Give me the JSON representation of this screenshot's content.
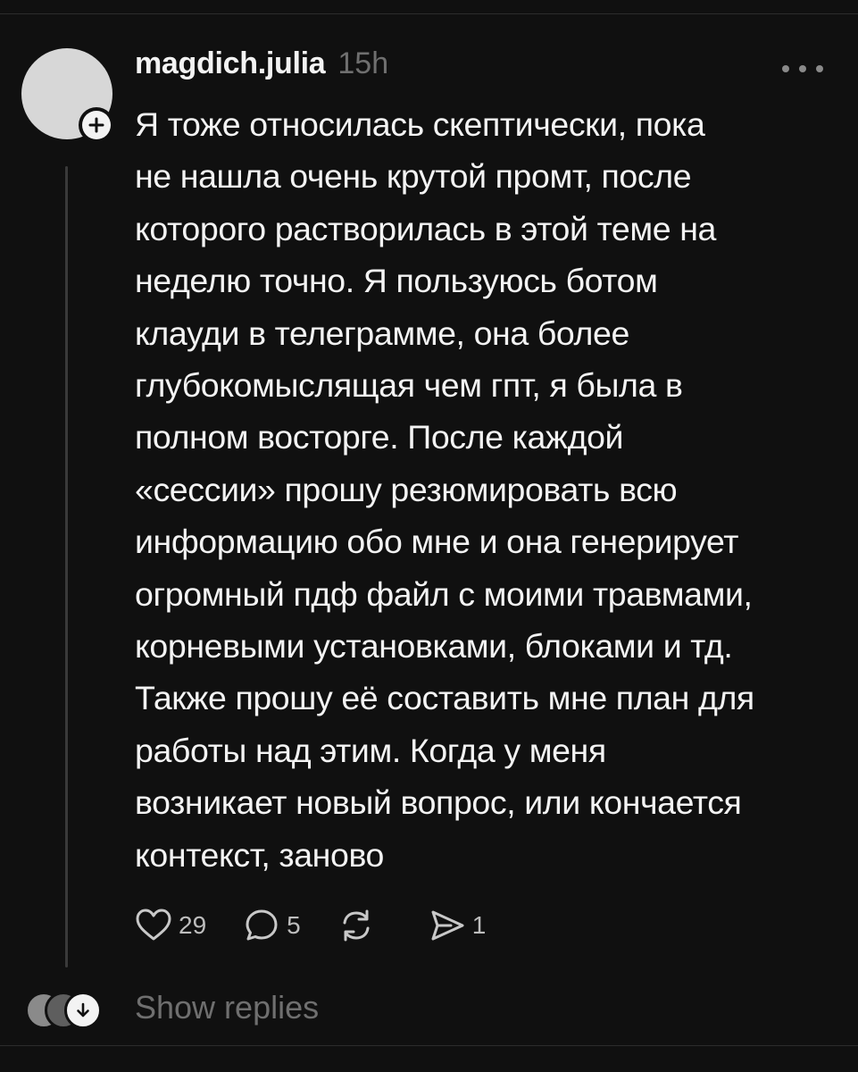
{
  "post": {
    "username": "magdich.julia",
    "timestamp": "15h",
    "text": "Я тоже относилась скептически, пока\nне нашла очень крутой промт, после\nкоторого растворилась в этой теме на\nнеделю точно. Я пользуюсь ботом\nклауди в телеграмме, она более\nглубокомыслящая чем гпт, я была в\nполном восторге. После каждой\n«сессии» прошу резюмировать всю\nинформацию обо мне и она генерирует\nогромный пдф файл с моими травмами,\nкорневыми установками, блоками и тд.\nТакже прошу её составить мне план для\nработы над этим. Когда у меня\nвозникает новый вопрос, или кончается\nконтекст,  заново"
  },
  "actions": {
    "likes": "29",
    "comments": "5",
    "shares": "1"
  },
  "replies": {
    "label": "Show replies"
  },
  "icons": {
    "more": "more-horizontal-icon",
    "follow": "plus-icon",
    "like": "heart-icon",
    "comment": "comment-icon",
    "repost": "repost-icon",
    "share": "send-icon",
    "expand": "arrow-down-icon"
  },
  "colors": {
    "background": "#101010",
    "text": "#f3f3f3",
    "muted": "#6f6f6f",
    "avatar": "#d7d7d7"
  }
}
